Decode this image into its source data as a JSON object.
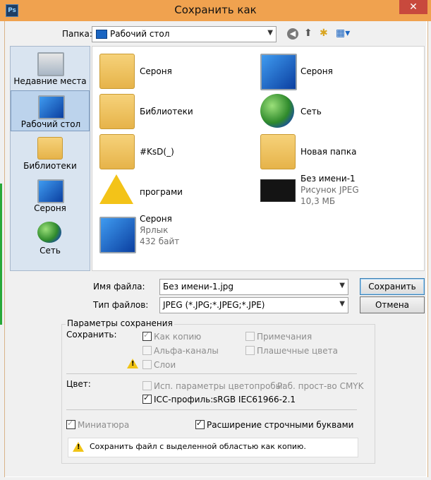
{
  "window": {
    "title": "Сохранить как",
    "app_icon": "Ps",
    "close_glyph": "✕"
  },
  "toolbar": {
    "folder_label": "Папка:",
    "folder_value": "Рабочий стол"
  },
  "sidebar": {
    "items": [
      {
        "label": "Недавние места",
        "icon": "recent-places-icon"
      },
      {
        "label": "Рабочий стол",
        "icon": "desktop-icon",
        "active": true
      },
      {
        "label": "Библиотеки",
        "icon": "libraries-icon"
      },
      {
        "label": "Сероня",
        "icon": "computer-icon"
      },
      {
        "label": "Сеть",
        "icon": "network-icon"
      }
    ]
  },
  "files": [
    {
      "name": "Сероня",
      "icon": "user-folder-icon"
    },
    {
      "name": "Сероня",
      "icon": "computer-icon"
    },
    {
      "name": "Библиотеки",
      "icon": "libraries-folder-icon"
    },
    {
      "name": "Сеть",
      "icon": "network-icon"
    },
    {
      "name": "#KsD(_)",
      "icon": "folder-icon"
    },
    {
      "name": "Новая папка",
      "icon": "folder-icon"
    },
    {
      "name": "програми",
      "icon": "warning-icon"
    },
    {
      "name": "Без имени-1",
      "sub1": "Рисунок JPEG",
      "sub2": "10,3 МБ",
      "icon": "jpeg-thumb-icon"
    },
    {
      "name": "Сероня",
      "sub1": "Ярлык",
      "sub2": "432 байт",
      "icon": "shortcut-icon"
    }
  ],
  "form": {
    "filename_label": "Имя файла:",
    "filename_value": "Без имени-1.jpg",
    "filetype_label": "Тип файлов:",
    "filetype_value": "JPEG (*.JPG;*.JPEG;*.JPE)",
    "save_label": "Сохранить",
    "cancel_label": "Отмена"
  },
  "options": {
    "title": "Параметры сохранения",
    "save_label": "Сохранить:",
    "as_copy": "Как копию",
    "notes": "Примечания",
    "alpha": "Альфа-каналы",
    "spot": "Плашечные цвета",
    "layers": "Слои",
    "color_label": "Цвет:",
    "proof": "Исп. параметры цветопробы:",
    "proof_value": "Раб. прост-во CMYK",
    "icc": "ICC-профиль:",
    "icc_value": "sRGB IEC61966-2.1",
    "thumbnail": "Миниатюра",
    "lowercase": "Расширение строчными буквами",
    "note": "Сохранить файл с выделенной областью как копию."
  }
}
